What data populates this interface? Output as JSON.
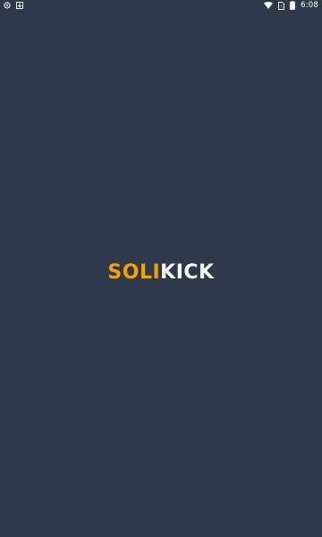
{
  "status_bar": {
    "left_icons": [
      "app-notification-icon",
      "download-icon"
    ],
    "right_icons": [
      "wifi-icon",
      "sim-icon",
      "battery-icon"
    ],
    "time": "6:08"
  },
  "splash": {
    "logo_part1": "SOLI",
    "logo_part2": "KICK",
    "colors": {
      "background": "#2e3a4b",
      "accent": "#f4a300",
      "text": "#ffffff"
    }
  }
}
